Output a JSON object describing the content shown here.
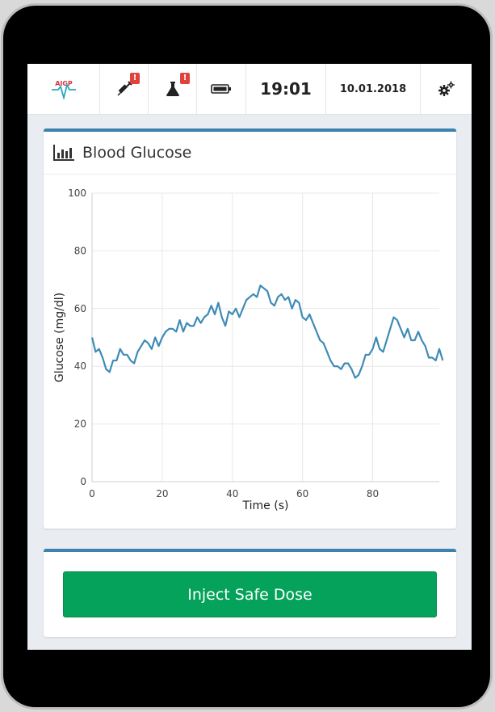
{
  "statusbar": {
    "logo_text": "AIGP",
    "syringe_alert": "!",
    "lab_alert": "!",
    "time": "19:01",
    "date": "10.01.2018",
    "icons": [
      "aigp-logo-icon",
      "syringe-icon",
      "flask-icon",
      "battery-icon",
      "gears-icon"
    ]
  },
  "glucose_panel": {
    "title": "Blood Glucose",
    "icon": "bar-chart-icon"
  },
  "action_panel": {
    "inject_label": "Inject Safe Dose"
  },
  "colors": {
    "accent": "#3d82ae",
    "line": "#3f8bb6",
    "button": "#04a25a",
    "alert": "#e0413a"
  },
  "chart_data": {
    "type": "line",
    "title": "",
    "xlabel": "Time (s)",
    "ylabel": "Glucose (mg/dl)",
    "xlim": [
      0,
      99
    ],
    "ylim": [
      0,
      100
    ],
    "xticks": [
      0,
      20,
      40,
      60,
      80
    ],
    "yticks": [
      0,
      20,
      40,
      60,
      80,
      100
    ],
    "grid": true,
    "series": [
      {
        "values": [
          50,
          45,
          46,
          43,
          39,
          38,
          42,
          42,
          46,
          44,
          44,
          42,
          41,
          45,
          47,
          49,
          48,
          46,
          50,
          47,
          50,
          52,
          53,
          53,
          52,
          56,
          52,
          55,
          54,
          54,
          57,
          55,
          57,
          58,
          61,
          58,
          62,
          57,
          54,
          59,
          58,
          60,
          57,
          60,
          63,
          64,
          65,
          64,
          68,
          67,
          66,
          62,
          61,
          64,
          65,
          63,
          64,
          60,
          63,
          62,
          57,
          56,
          58,
          55,
          52,
          49,
          48,
          45,
          42,
          40,
          40,
          39,
          41,
          41,
          39,
          36,
          37,
          40,
          44,
          44,
          46,
          50,
          46,
          45,
          49,
          53,
          57,
          56,
          53,
          50,
          53,
          49,
          49,
          52,
          49,
          47,
          43,
          43,
          42,
          46,
          42
        ]
      }
    ]
  }
}
